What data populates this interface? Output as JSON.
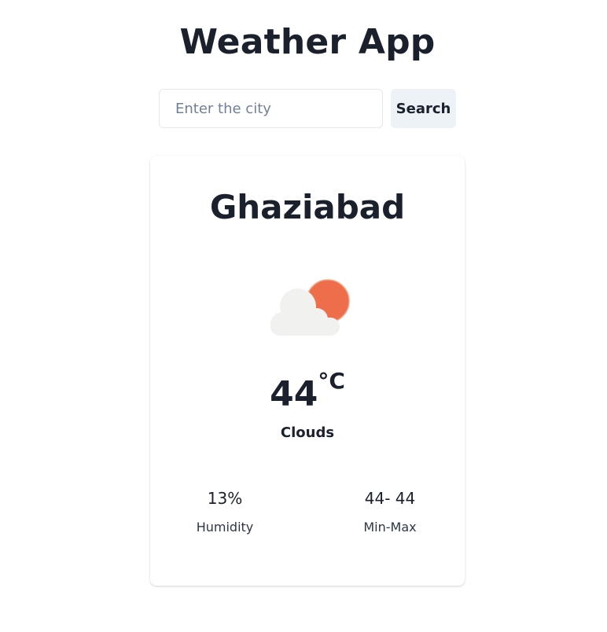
{
  "app": {
    "title": "Weather App"
  },
  "search": {
    "placeholder": "Enter the city",
    "value": "",
    "button_label": "Search"
  },
  "weather": {
    "city": "Ghaziabad",
    "icon": "cloud-with-sun-icon",
    "temperature": "44",
    "unit": "°C",
    "condition": "Clouds",
    "humidity": {
      "value": "13%",
      "label": "Humidity"
    },
    "min_max": {
      "value": "44- 44",
      "label": "Min-Max"
    }
  },
  "colors": {
    "sun": "#ee6e4b",
    "cloud": "#f1f1f0",
    "text": "#1a202c",
    "button_bg": "#edf2f7",
    "input_border": "#e2e8f0"
  }
}
